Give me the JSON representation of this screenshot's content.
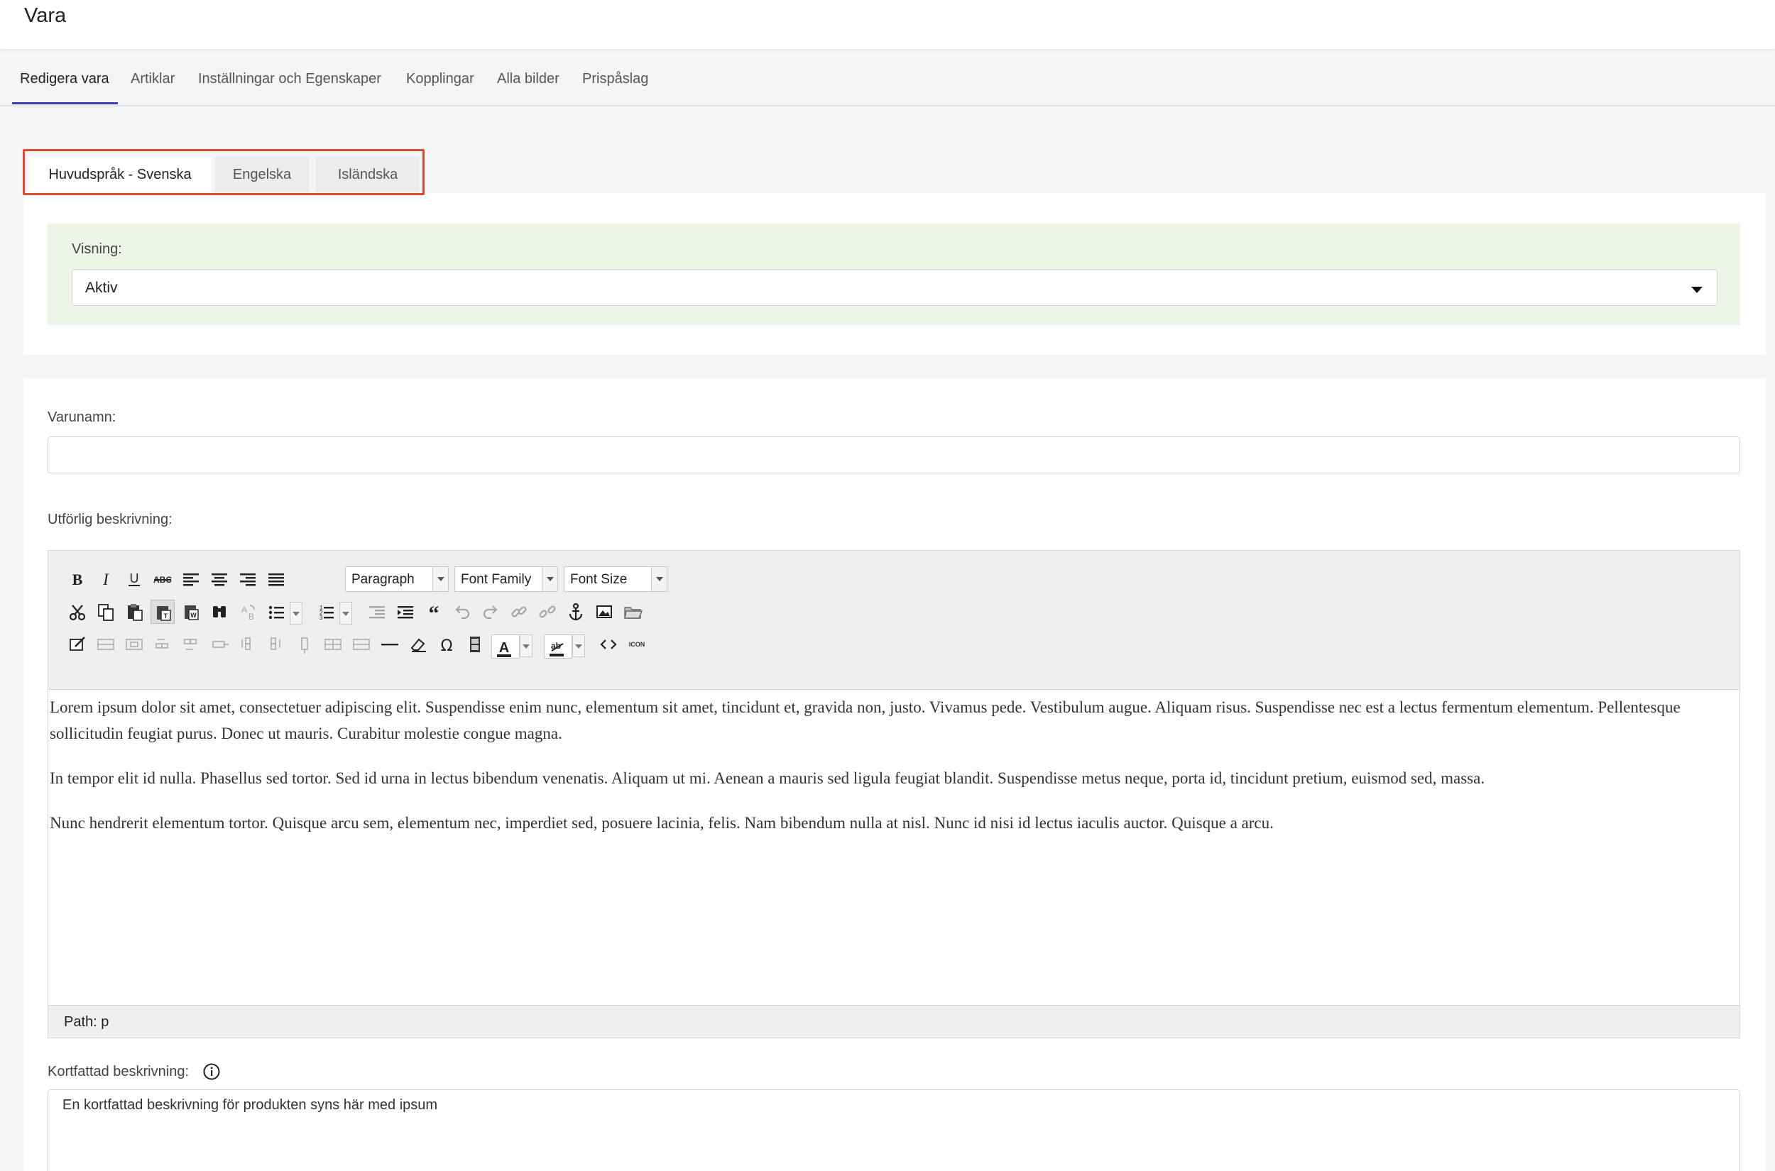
{
  "page": {
    "title": "Vara"
  },
  "nav_tabs": [
    {
      "label": "Redigera vara"
    },
    {
      "label": "Artiklar"
    },
    {
      "label": "Inställningar och Egenskaper"
    },
    {
      "label": "Kopplingar"
    },
    {
      "label": "Alla bilder"
    },
    {
      "label": "Prispåslag"
    }
  ],
  "nav_tab_selected": "Redigera vara",
  "language_tabs": [
    {
      "label": "Huvudspråk - Svenska"
    },
    {
      "label": "Engelska"
    },
    {
      "label": "Isländska"
    }
  ],
  "language_tab_selected": "Huvudspråk - Svenska",
  "visibility": {
    "label": "Visning:",
    "value": "Aktiv"
  },
  "product_name": {
    "label": "Varunamn:",
    "value": ""
  },
  "long_description": {
    "label": "Utförlig beskrivning:",
    "toolbar": {
      "format_select": "Paragraph",
      "font_family_select": "Font Family",
      "font_size_select": "Font Size"
    },
    "paragraphs": [
      "Lorem ipsum dolor sit amet, consectetuer adipiscing elit. Suspendisse enim nunc, elementum sit amet, tincidunt et, gravida non, justo. Vivamus pede. Vestibulum augue. Aliquam risus. Suspendisse nec est a lectus fermentum elementum. Pellentesque sollicitudin feugiat purus. Donec ut mauris. Curabitur molestie  congue magna.",
      "In tempor elit id nulla. Phasellus sed tortor. Sed id urna in lectus bibendum venenatis. Aliquam ut mi. Aenean a mauris sed ligula feugiat blandit. Suspendisse metus neque, porta id, tincidunt pretium, euismod sed, massa.",
      "Nunc hendrerit elementum tortor. Quisque arcu sem, elementum nec, imperdiet sed, posuere lacinia, felis. Nam bibendum nulla at nisl. Nunc id nisi id lectus iaculis auctor. Quisque a arcu."
    ],
    "path": "Path: p"
  },
  "short_description": {
    "label": "Kortfattad beskrivning:",
    "value": "En kortfattad beskrivning för produkten syns här med ipsum"
  },
  "colors": {
    "active_tab_underline": "#3f3fb0",
    "highlight_border": "#e04a2f",
    "visibility_background": "#edf5e6",
    "page_background": "#f4f5f7"
  }
}
